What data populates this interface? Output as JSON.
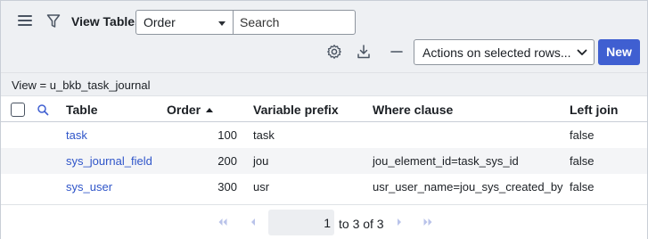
{
  "header": {
    "title": "View Tables",
    "order_select": "Order",
    "search_placeholder": "Search",
    "actions_select": "Actions on selected rows...",
    "new_label": "New"
  },
  "breadcrumb": "View = u_bkb_task_journal",
  "table": {
    "columns": [
      "Table",
      "Order",
      "Variable prefix",
      "Where clause",
      "Left join"
    ],
    "rows": [
      {
        "table": "task",
        "order": "100",
        "prefix": "task",
        "where": "",
        "left_join": "false"
      },
      {
        "table": "sys_journal_field",
        "order": "200",
        "prefix": "jou",
        "where": "jou_element_id=task_sys_id",
        "left_join": "false"
      },
      {
        "table": "sys_user",
        "order": "300",
        "prefix": "usr",
        "where": "usr_user_name=jou_sys_created_by",
        "left_join": "false"
      }
    ]
  },
  "pagination": {
    "page_value": "1",
    "range_text": "to 3 of 3"
  },
  "colors": {
    "accent": "#3f5fd1",
    "link": "#2f55c9",
    "header_bg": "#eef0f3"
  },
  "icons": [
    "hamburger-menu-icon",
    "filter-icon",
    "gear-icon",
    "download-icon",
    "minus-icon",
    "chevron-down-icon",
    "search-icon",
    "first-page-icon",
    "prev-page-icon",
    "next-page-icon",
    "last-page-icon"
  ]
}
